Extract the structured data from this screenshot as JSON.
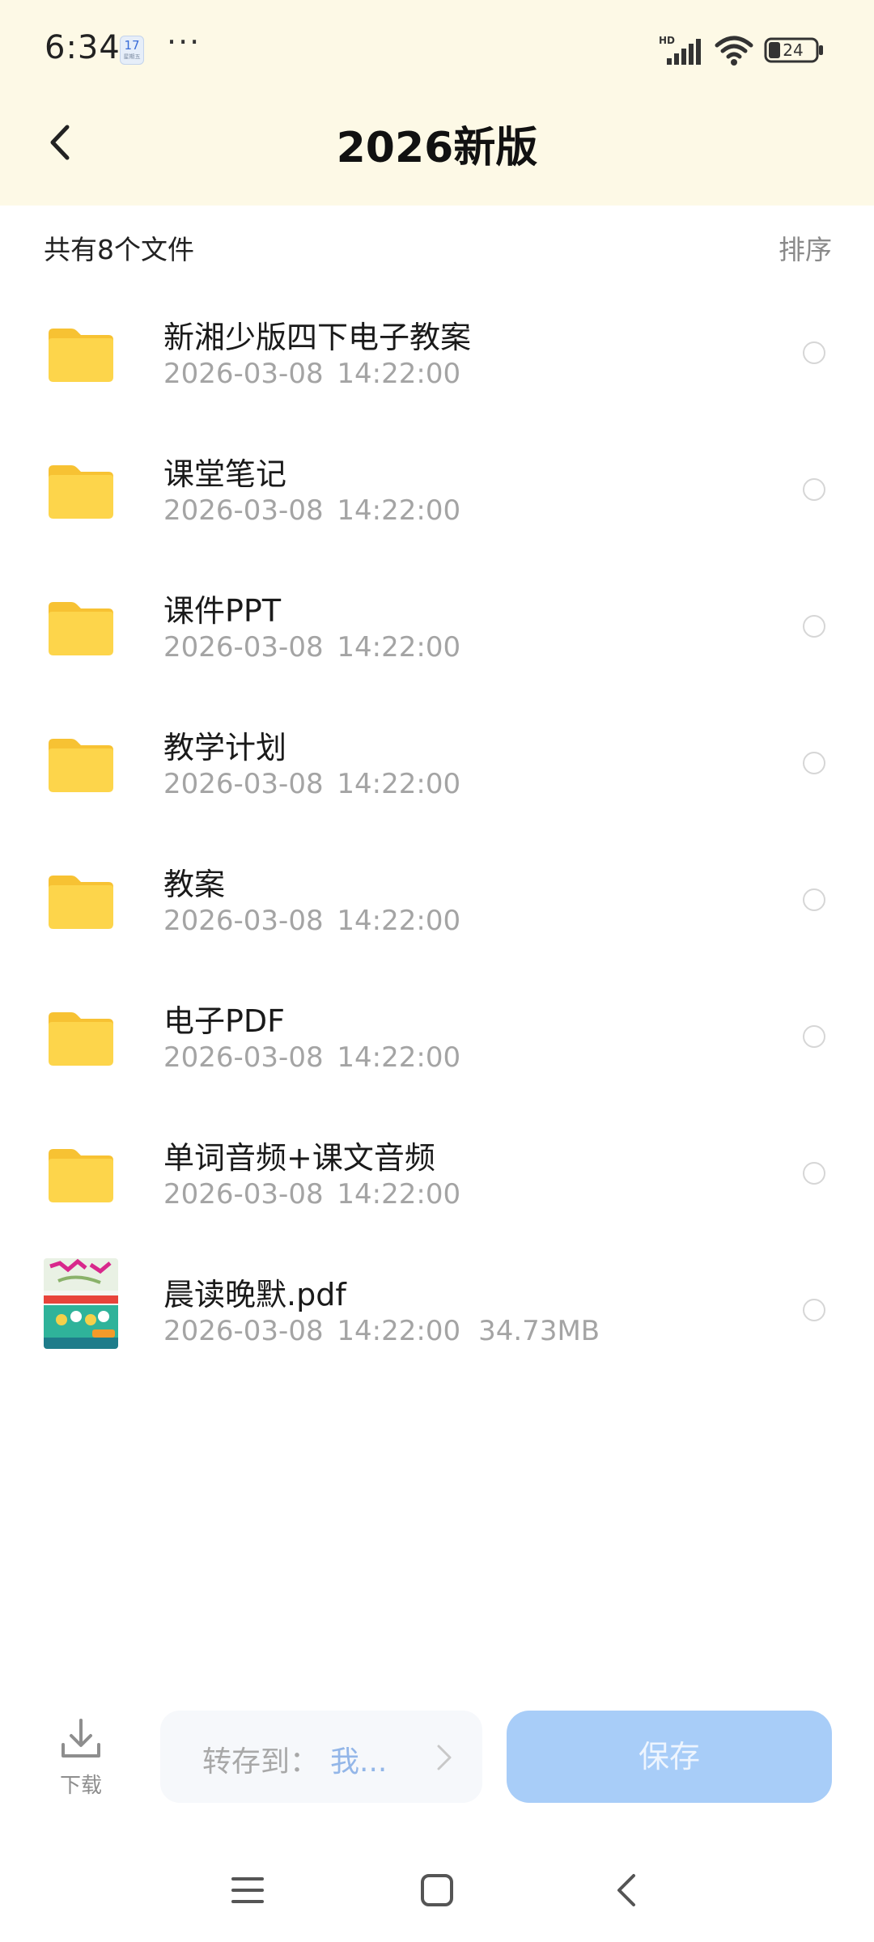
{
  "status_bar": {
    "time": "6:34",
    "calendar_day": "17",
    "calendar_sub": "星期五",
    "more_dots": "···",
    "network_label": "HD",
    "battery": "24"
  },
  "header": {
    "title": "2026新版",
    "background_color": "#fdf9e6"
  },
  "summary": {
    "file_count_text": "共有8个文件",
    "sort_label": "排序"
  },
  "files": [
    {
      "name": "新湘少版四下电子教案",
      "date": "2026-03-08",
      "time": "14:22:00",
      "type": "folder"
    },
    {
      "name": "课堂笔记",
      "date": "2026-03-08",
      "time": "14:22:00",
      "type": "folder"
    },
    {
      "name": "课件PPT",
      "date": "2026-03-08",
      "time": "14:22:00",
      "type": "folder"
    },
    {
      "name": "教学计划",
      "date": "2026-03-08",
      "time": "14:22:00",
      "type": "folder"
    },
    {
      "name": "教案",
      "date": "2026-03-08",
      "time": "14:22:00",
      "type": "folder"
    },
    {
      "name": "电子PDF",
      "date": "2026-03-08",
      "time": "14:22:00",
      "type": "folder"
    },
    {
      "name": "单词音频+课文音频",
      "date": "2026-03-08",
      "time": "14:22:00",
      "type": "folder"
    },
    {
      "name": "晨读晚默.pdf",
      "date": "2026-03-08",
      "time": "14:22:00",
      "size": "34.73MB",
      "type": "pdf"
    }
  ],
  "action_bar": {
    "download_label": "下载",
    "saveto_label": "转存到：",
    "saveto_value": "我...",
    "save_label": "保存",
    "save_color": "#a8cdf8"
  },
  "icons": {
    "back": "chevron-left-icon",
    "folder": "folder-icon",
    "download": "download-icon",
    "nav_menu": "menu-icon",
    "nav_home": "home-square-icon",
    "nav_back": "back-chevron-icon"
  }
}
